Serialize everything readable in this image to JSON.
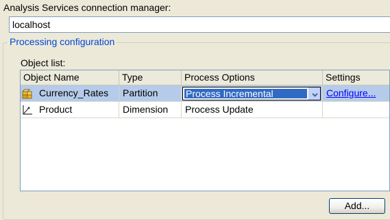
{
  "connection": {
    "label": "Analysis Services connection manager:",
    "value": "localhost"
  },
  "processing": {
    "group_title": "Processing configuration",
    "object_list_label": "Object list:",
    "columns": [
      "Object Name",
      "Type",
      "Process Options",
      "Settings"
    ],
    "rows": [
      {
        "icon": "partition-cube-icon",
        "name": "Currency_Rates",
        "type": "Partition",
        "process_option": "Process Incremental",
        "settings": "Configure...",
        "selected": true
      },
      {
        "icon": "dimension-axis-icon",
        "name": "Product",
        "type": "Dimension",
        "process_option": "Process Update",
        "settings": "",
        "selected": false
      }
    ],
    "add_button": "Add..."
  },
  "colors": {
    "group_title": "#0046d5",
    "selected_row": "#b6cbea",
    "combo_highlight": "#316ac5",
    "link": "#0000ff"
  }
}
